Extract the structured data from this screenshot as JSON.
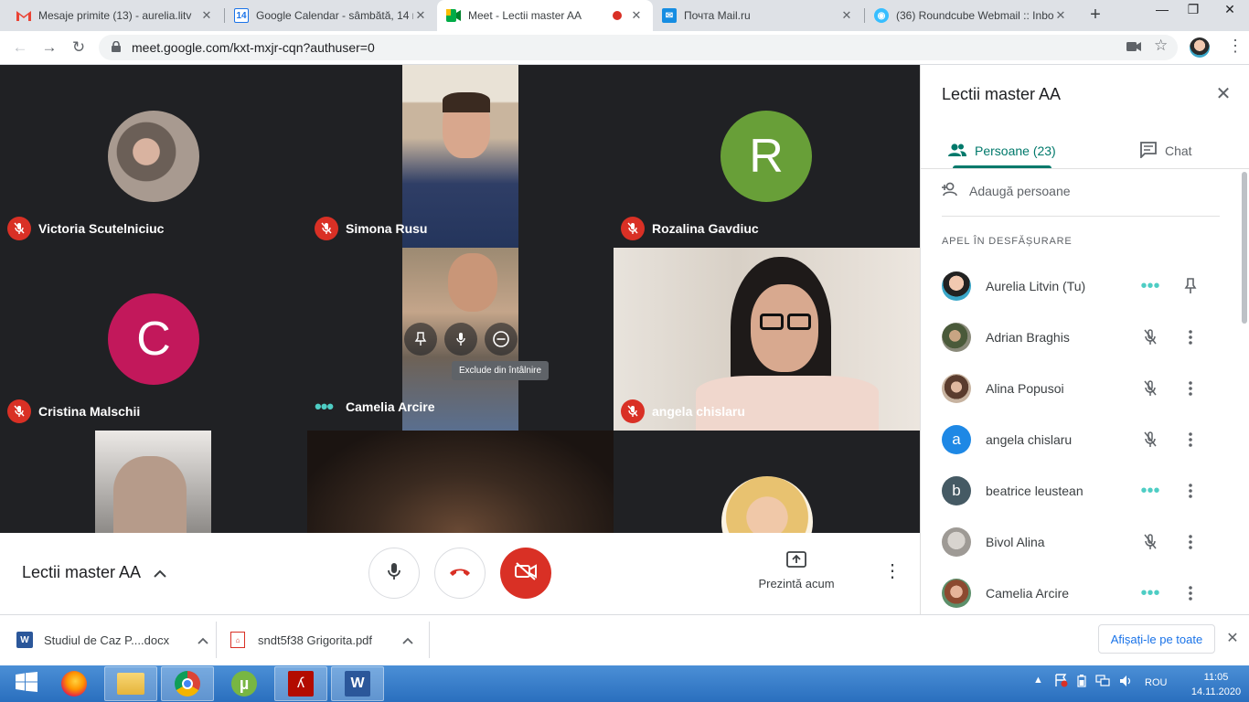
{
  "browser": {
    "tabs": [
      {
        "title": "Mesaje primite (13) - aurelia.litv",
        "favicon": "gmail-icon"
      },
      {
        "title": "Google Calendar - sâmbătă, 14 n",
        "favicon": "calendar-icon",
        "badge": "14"
      },
      {
        "title": "Meet - Lectii master AA",
        "favicon": "meet-icon",
        "active": true
      },
      {
        "title": "Почта Mail.ru",
        "favicon": "mailru-icon"
      },
      {
        "title": "(36) Roundcube Webmail :: Inbo",
        "favicon": "roundcube-icon"
      }
    ],
    "url": "meet.google.com/kxt-mxjr-cqn?authuser=0"
  },
  "tiles": [
    {
      "name": "Victoria Scutelniciuc",
      "status": "muted",
      "kind": "photo-avatar"
    },
    {
      "name": "Simona Rusu",
      "status": "muted",
      "kind": "video"
    },
    {
      "name": "Rozalina Gavdiuc",
      "status": "muted",
      "kind": "letter",
      "letter": "R",
      "color": "#689f38"
    },
    {
      "name": "Cristina Malschii",
      "status": "muted",
      "kind": "letter",
      "letter": "C",
      "color": "#c2185b"
    },
    {
      "name": "Camelia Arcire",
      "status": "speaking",
      "kind": "video"
    },
    {
      "name": "angela chislaru",
      "status": "muted",
      "kind": "video"
    }
  ],
  "hover_tooltip": "Exclude din întâlnire",
  "meeting": {
    "title": "Lectii master AA",
    "present_label": "Prezintă acum"
  },
  "panel": {
    "title": "Lectii master AA",
    "tab_people": "Persoane (23)",
    "tab_chat": "Chat",
    "add_people": "Adaugă persoane",
    "section_heading": "APEL ÎN DESFĂȘURARE",
    "people": [
      {
        "name": "Aurelia Litvin (Tu)",
        "status": "speaking",
        "action": "pin",
        "avatar": "photo"
      },
      {
        "name": "Adrian Braghis",
        "status": "muted",
        "action": "more",
        "avatar": "photo"
      },
      {
        "name": "Alina Popusoi",
        "status": "muted",
        "action": "more",
        "avatar": "photo"
      },
      {
        "name": "angela chislaru",
        "status": "muted",
        "action": "more",
        "avatar": "letter",
        "letter": "a",
        "color": "#1e88e5"
      },
      {
        "name": "beatrice leustean",
        "status": "speaking",
        "action": "more",
        "avatar": "letter",
        "letter": "b",
        "color": "#455a64"
      },
      {
        "name": "Bivol Alina",
        "status": "muted",
        "action": "more",
        "avatar": "photo"
      },
      {
        "name": "Camelia Arcire",
        "status": "speaking",
        "action": "more",
        "avatar": "photo"
      }
    ]
  },
  "downloads": [
    {
      "name": "Studiul de Caz P....docx",
      "icon": "word-doc-icon"
    },
    {
      "name": "sndt5f38 Grigorita.pdf",
      "icon": "pdf-icon"
    }
  ],
  "show_all": "Afișați-le pe toate",
  "taskbar": {
    "lang": "ROU",
    "time": "11:05",
    "date": "14.11.2020"
  },
  "colors": {
    "meet_teal": "#00796b",
    "hangup_red": "#d93025",
    "stage_bg": "#202124"
  }
}
